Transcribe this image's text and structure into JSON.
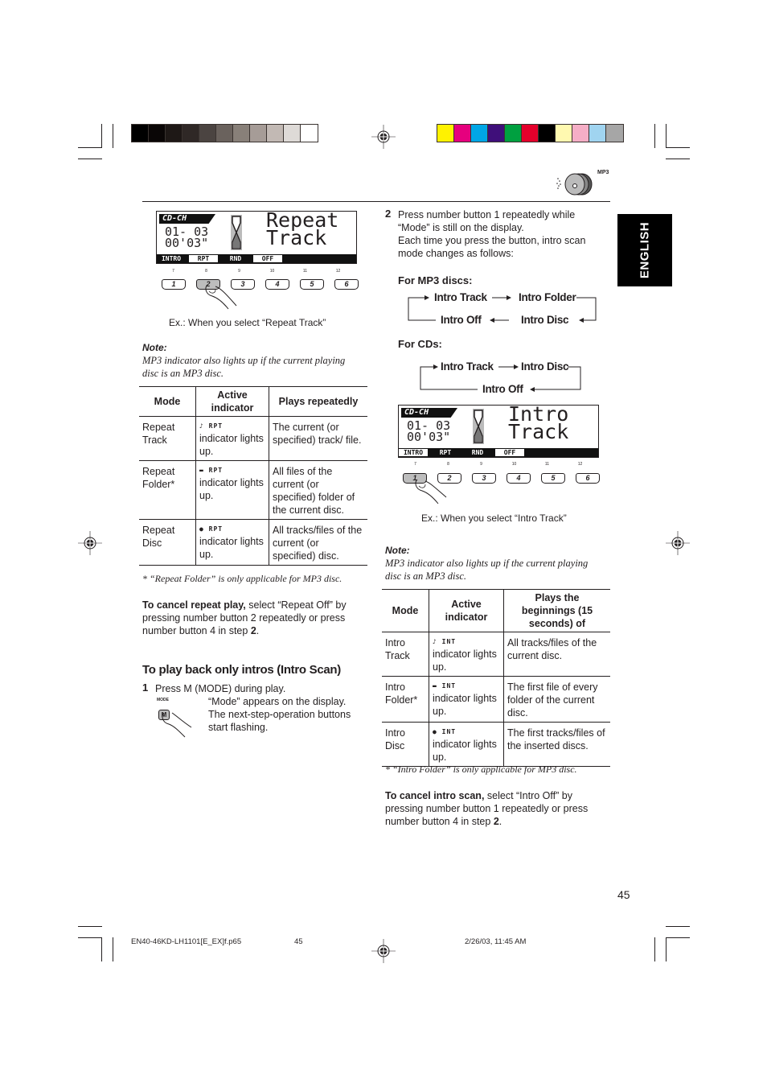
{
  "print_marks": {
    "gray_swatches": [
      "#000000",
      "#0a0606",
      "#1e1816",
      "#2f2826",
      "#4b4441",
      "#6a625d",
      "#888079",
      "#a69c97",
      "#c2b9b4",
      "#dedad7",
      "#ffffff"
    ],
    "color_swatches": [
      "#fff200",
      "#e6007e",
      "#00a6e6",
      "#3f0f7a",
      "#00a040",
      "#e4002b",
      "#000000",
      "#fff9b0",
      "#f5aec6",
      "#a0d4f0",
      "#a6a6a6"
    ]
  },
  "header": {
    "mp3_badge": "MP3",
    "language_tab": "ENGLISH"
  },
  "left": {
    "display1": {
      "source": "CD-CH",
      "line1": "01- 03",
      "line2": "00'03\"",
      "big_line1": "Repeat",
      "big_line2": "Track",
      "segments": [
        {
          "label": "INTRO",
          "on": false
        },
        {
          "label": "RPT",
          "on": true
        },
        {
          "label": "RND",
          "on": false
        },
        {
          "label": "OFF",
          "on": true
        },
        {
          "label": "",
          "on": false
        },
        {
          "label": "",
          "on": false
        }
      ],
      "upper_numbers": [
        "7",
        "8",
        "9",
        "10",
        "11",
        "12"
      ],
      "buttons": [
        "1",
        "2",
        "3",
        "4",
        "5",
        "6"
      ],
      "pressed_index": 1
    },
    "caption1": "Ex.:  When you select “Repeat Track”",
    "note_heading": "Note:",
    "note_text": "MP3 indicator also lights up if the current playing disc is an MP3 disc.",
    "repeat_table": {
      "headers": [
        "Mode",
        "Active indicator",
        "Plays repeatedly"
      ],
      "rows": [
        {
          "mode": "Repeat Track",
          "indicator_icon": "♪ RPT",
          "indicator_text": "indicator lights up.",
          "plays": "The current (or specified) track/ file."
        },
        {
          "mode": "Repeat Folder*",
          "indicator_icon": "▬ RPT",
          "indicator_text": "indicator lights up.",
          "plays": "All files of the current (or specified) folder of the current disc."
        },
        {
          "mode": "Repeat Disc",
          "indicator_icon": "● RPT",
          "indicator_text": "indicator lights up.",
          "plays": "All tracks/files of the current (or specified) disc."
        }
      ]
    },
    "footnote": "*  “Repeat Folder” is only applicable for MP3 disc.",
    "cancel_bold": "To cancel repeat play,",
    "cancel_rest": " select “Repeat Off” by pressing number button 2 repeatedly or press number button 4 in step ",
    "cancel_step": "2",
    "intro_heading": "To play back only intros (Intro Scan)",
    "step1_num": "1",
    "step1_text": "Press M (MODE) during play.",
    "mode_label": "MODE",
    "mode_key": "M",
    "step1_detail": "“Mode” appears on the display. The next-step-operation buttons start flashing."
  },
  "right": {
    "step2_num": "2",
    "step2_text": "Press number button 1 repeatedly while “Mode” is still on the display.",
    "step2_detail": "Each time you press the button, intro scan mode changes as follows:",
    "mp3_label": "For MP3 discs:",
    "mp3_flow": [
      "Intro Track",
      "Intro Folder",
      "Intro Disc",
      "Intro Off"
    ],
    "cd_label": "For CDs:",
    "cd_flow": [
      "Intro Track",
      "Intro Disc",
      "Intro Off"
    ],
    "display2": {
      "source": "CD-CH",
      "line1": "01- 03",
      "line2": "00'03\"",
      "big_line1": "Intro",
      "big_line2": "Track",
      "segments": [
        {
          "label": "INTRO",
          "on": true
        },
        {
          "label": "RPT",
          "on": false
        },
        {
          "label": "RND",
          "on": false
        },
        {
          "label": "OFF",
          "on": true
        },
        {
          "label": "",
          "on": false
        },
        {
          "label": "",
          "on": false
        }
      ],
      "upper_numbers": [
        "7",
        "8",
        "9",
        "10",
        "11",
        "12"
      ],
      "buttons": [
        "1",
        "2",
        "3",
        "4",
        "5",
        "6"
      ],
      "pressed_index": 0
    },
    "caption2": "Ex.:  When you select “Intro Track”",
    "note_heading": "Note:",
    "note_text": "MP3 indicator also lights up if the current playing disc is an MP3 disc.",
    "intro_table": {
      "headers": [
        "Mode",
        "Active indicator",
        "Plays the beginnings (15 seconds) of"
      ],
      "rows": [
        {
          "mode": "Intro Track",
          "indicator_icon": "♪ INT",
          "indicator_text": "indicator lights up.",
          "plays": "All tracks/files of the current disc."
        },
        {
          "mode": "Intro Folder*",
          "indicator_icon": "▬ INT",
          "indicator_text": "indicator lights up.",
          "plays": "The first file of every folder of the current disc."
        },
        {
          "mode": "Intro Disc",
          "indicator_icon": "● INT",
          "indicator_text": "indicator lights up.",
          "plays": "The first tracks/files of the inserted discs."
        }
      ]
    },
    "footnote": "*  “Intro Folder” is only applicable for MP3 disc.",
    "cancel_bold": "To cancel intro scan,",
    "cancel_rest": " select “Intro Off” by pressing number button 1 repeatedly or press number button 4 in step ",
    "cancel_step": "2"
  },
  "footer": {
    "page_number": "45",
    "file_name": "EN40-46KD-LH1101[E_EX]f.p65",
    "slug_page": "45",
    "timestamp": "2/26/03, 11:45 AM"
  }
}
